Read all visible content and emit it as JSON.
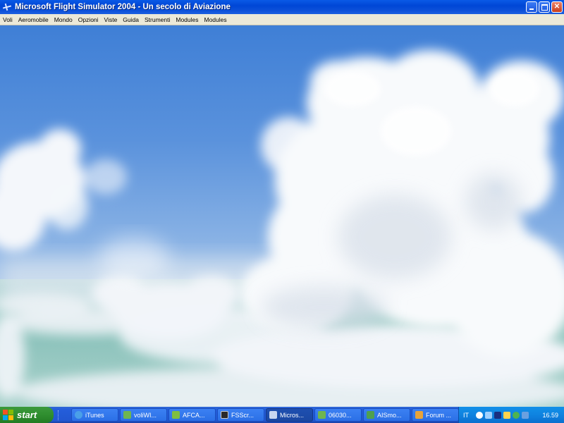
{
  "window": {
    "title": "Microsoft Flight Simulator 2004 - Un secolo di Aviazione",
    "icon": "airplane-icon"
  },
  "menu": {
    "items": [
      "Voli",
      "Aeromobile",
      "Mondo",
      "Opzioni",
      "Viste",
      "Guida",
      "Strumenti",
      "Modules",
      "Modules"
    ]
  },
  "taskbar": {
    "start_label": "start",
    "tasks": [
      {
        "label": "iTunes",
        "icon": "itunes-icon",
        "color": "#4aa0e8"
      },
      {
        "label": "voliWI...",
        "icon": "document-icon",
        "color": "#6fb64f"
      },
      {
        "label": "AFCA...",
        "icon": "plane-app-icon",
        "color": "#7fbf3f"
      },
      {
        "label": "FSScr...",
        "icon": "console-icon",
        "color": "#2a2a2a"
      },
      {
        "label": "Micros...",
        "icon": "flight-sim-icon",
        "color": "#c9d6f0",
        "active": true
      },
      {
        "label": "06030...",
        "icon": "document-icon",
        "color": "#6fb64f"
      },
      {
        "label": "AISmo...",
        "icon": "app-icon",
        "color": "#4fa04f"
      },
      {
        "label": "Forum ...",
        "icon": "browser-icon",
        "color": "#e8a33a"
      }
    ],
    "tray": {
      "language": "IT",
      "clock": "16.59"
    }
  },
  "colors": {
    "sky_top": "#3f7fd6",
    "sea": "#8ec6c0",
    "cloud": "#ffffff"
  }
}
